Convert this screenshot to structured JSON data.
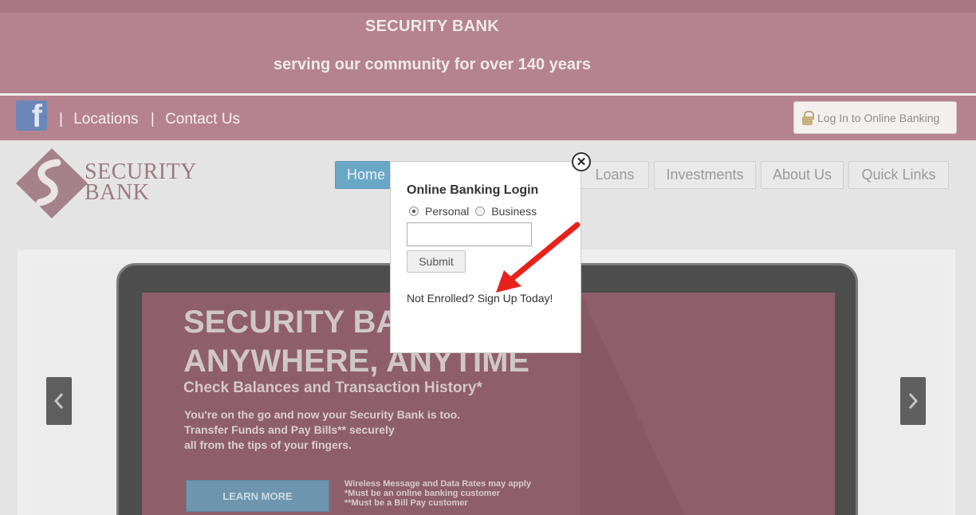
{
  "banner": {
    "title": "SECURITY BANK",
    "subtitle": "serving our community for over 140 years"
  },
  "utility": {
    "facebook_glyph": "f",
    "separator": "|",
    "locations": "Locations",
    "contact": "Contact Us",
    "login_button": "Log In to Online Banking"
  },
  "logo": {
    "line1": "SECURITY",
    "line2": "BANK"
  },
  "nav": {
    "items": [
      "Home",
      "Loans",
      "Investments",
      "About Us",
      "Quick Links"
    ],
    "active": "Home"
  },
  "hero": {
    "headline_line1": "SECURITY BA",
    "headline_line2": "ANYWHERE, ANYTIME",
    "subheadline": "Check Balances and Transaction History*",
    "body": "You're on the go and now your Security Bank is too.\nTransfer Funds and Pay Bills** securely\nall from the tips of your fingers.",
    "cta": "LEARN MORE",
    "fineprint": "Wireless Message and Data Rates may apply\n*Must be an online banking customer\n**Must be a Bill Pay customer"
  },
  "modal": {
    "title": "Online Banking Login",
    "options": [
      "Personal",
      "Business"
    ],
    "selected": "Personal",
    "input_value": "",
    "submit": "Submit",
    "enroll": "Not Enrolled? Sign Up Today!",
    "close_glyph": "✕"
  },
  "colors": {
    "brand": "#b4838f",
    "nav_active": "#69a7c6",
    "annotation_arrow": "#e8221a"
  }
}
